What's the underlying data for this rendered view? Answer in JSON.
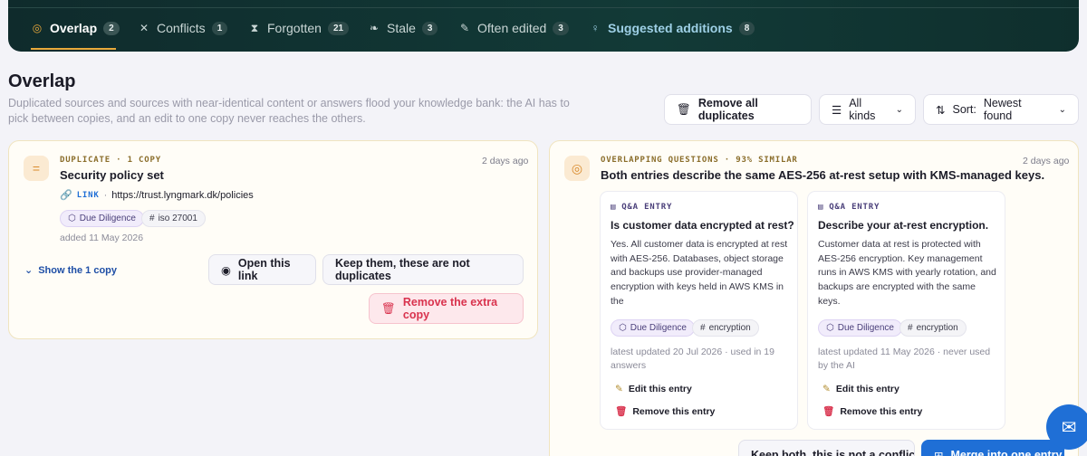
{
  "tabs": [
    {
      "label": "Overlap",
      "count": "2",
      "icon": "overlap-icon"
    },
    {
      "label": "Conflicts",
      "count": "1",
      "icon": "conflicts-icon"
    },
    {
      "label": "Forgotten",
      "count": "21",
      "icon": "hourglass-icon"
    },
    {
      "label": "Stale",
      "count": "3",
      "icon": "leaf-icon"
    },
    {
      "label": "Often edited",
      "count": "3",
      "icon": "pencil-icon"
    },
    {
      "label": "Suggested additions",
      "count": "8",
      "icon": "lightbulb-icon"
    }
  ],
  "page": {
    "title": "Overlap",
    "description": "Duplicated sources and sources with near-identical content or answers flood your knowledge bank: the AI has to pick between copies, and an edit to one copy never reaches the others."
  },
  "toolbar": {
    "remove_all": "Remove all duplicates",
    "kinds": "All kinds",
    "sort_label": "Sort:",
    "sort_value": "Newest found"
  },
  "duplicate_card": {
    "kind": "DUPLICATE · 1 COPY",
    "title": "Security policy set",
    "ago": "2 days ago",
    "link_label": "LINK",
    "link_sep": "·",
    "link_url": "https://trust.lyngmark.dk/policies",
    "tags": [
      "Due Diligence",
      "iso 27001"
    ],
    "added": "added 11 May 2026",
    "show_copy": "Show the 1 copy",
    "open_link": "Open this link",
    "keep": "Keep them, these are not duplicates",
    "remove_extra": "Remove the extra copy"
  },
  "overlap_card": {
    "kind": "OVERLAPPING QUESTIONS · 93% SIMILAR",
    "title": "Both entries describe the same AES-256 at-rest setup with KMS-managed keys.",
    "ago": "2 days ago",
    "entries": [
      {
        "kind": "Q&A ENTRY",
        "title": "Is customer data encrypted at rest?",
        "body": "Yes. All customer data is encrypted at rest with AES-256. Databases, object storage and backups use provider-managed encryption with keys held in AWS KMS in the",
        "tags": [
          "Due Diligence",
          "encryption"
        ],
        "meta": "latest updated 20 Jul 2026 · used in 19 answers",
        "edit": "Edit this entry",
        "remove": "Remove this entry"
      },
      {
        "kind": "Q&A ENTRY",
        "title": "Describe your at-rest encryption.",
        "body": "Customer data at rest is protected with AES-256 encryption. Key management runs in AWS KMS with yearly rotation, and backups are encrypted with the same keys.",
        "tags": [
          "Due Diligence",
          "encryption"
        ],
        "meta": "latest updated 11 May 2026 · never used by the AI",
        "edit": "Edit this entry",
        "remove": "Remove this entry"
      }
    ],
    "keep_both": "Keep both, this is not a conflict",
    "merge": "Merge into one entry"
  },
  "colors": {
    "accent": "#e8a93b",
    "danger": "#d9334e",
    "primary": "#1f6fd6"
  }
}
